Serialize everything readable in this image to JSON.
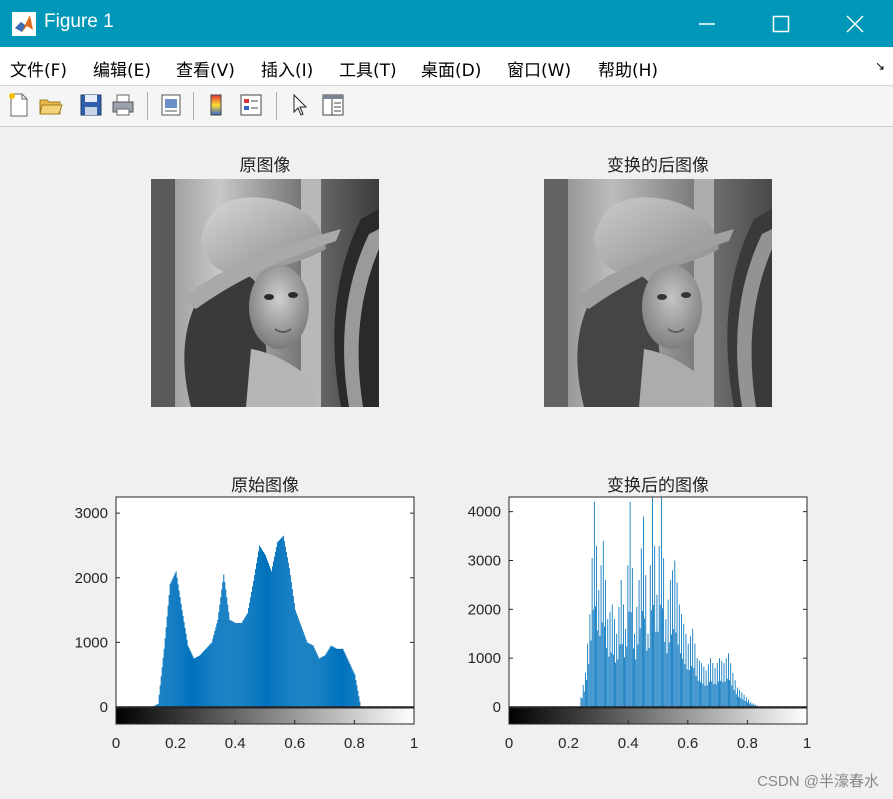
{
  "window": {
    "title": "Figure 1"
  },
  "menu": [
    "文件(F)",
    "编辑(E)",
    "查看(V)",
    "插入(I)",
    "工具(T)",
    "桌面(D)",
    "窗口(W)",
    "帮助(H)"
  ],
  "toolbar_icons": [
    "new-figure-icon",
    "open-file-icon",
    "save-icon",
    "print-icon",
    "print-preview-icon",
    "colorbar-icon",
    "legend-icon",
    "edit-plot-pointer-icon",
    "property-inspector-icon"
  ],
  "images": [
    {
      "title": "原图像"
    },
    {
      "title": "变换的后图像"
    }
  ],
  "colors": {
    "titlebar": "#0097b8",
    "bar": "#0072bd"
  },
  "chart_data": [
    {
      "type": "bar",
      "title": "原始图像",
      "xlim": [
        0,
        1
      ],
      "ylim": [
        0,
        3250
      ],
      "xticks": [
        "0",
        "0.2",
        "0.4",
        "0.6",
        "0.8",
        "1"
      ],
      "yticks": [
        "0",
        "1000",
        "2000",
        "3000"
      ],
      "colorbar": "grayscale",
      "x": [
        0.1,
        0.12,
        0.14,
        0.16,
        0.18,
        0.2,
        0.22,
        0.24,
        0.26,
        0.28,
        0.3,
        0.32,
        0.34,
        0.36,
        0.38,
        0.4,
        0.42,
        0.44,
        0.46,
        0.48,
        0.5,
        0.52,
        0.54,
        0.56,
        0.58,
        0.6,
        0.62,
        0.64,
        0.66,
        0.68,
        0.7,
        0.72,
        0.74,
        0.76,
        0.78,
        0.8,
        0.82,
        0.84,
        0.86,
        0.88,
        0.9
      ],
      "values": [
        0,
        0,
        50,
        900,
        1900,
        2100,
        1500,
        950,
        750,
        800,
        900,
        1000,
        1350,
        2050,
        1350,
        1300,
        1300,
        1450,
        1950,
        2500,
        2350,
        2100,
        2550,
        2650,
        2150,
        1500,
        1250,
        1000,
        950,
        750,
        800,
        950,
        900,
        900,
        700,
        500,
        0,
        0,
        0,
        0,
        0
      ]
    },
    {
      "type": "bar",
      "title": "变换后的图像",
      "xlim": [
        0,
        1
      ],
      "ylim": [
        0,
        4300
      ],
      "xticks": [
        "0",
        "0.2",
        "0.4",
        "0.6",
        "0.8",
        "1"
      ],
      "yticks": [
        "0",
        "1000",
        "2000",
        "3000",
        "4000"
      ],
      "colorbar": "grayscale",
      "x": [
        0.24,
        0.255,
        0.27,
        0.285,
        0.3,
        0.315,
        0.33,
        0.345,
        0.36,
        0.375,
        0.39,
        0.405,
        0.42,
        0.435,
        0.45,
        0.465,
        0.48,
        0.495,
        0.51,
        0.525,
        0.54,
        0.555,
        0.57,
        0.585,
        0.6,
        0.615,
        0.63,
        0.645,
        0.66,
        0.675,
        0.69,
        0.705,
        0.72,
        0.735,
        0.75,
        0.765,
        0.78,
        0.795,
        0.81,
        0.825
      ],
      "values": [
        200,
        700,
        1900,
        4200,
        2400,
        3400,
        1800,
        2100,
        1500,
        2600,
        1600,
        4200,
        1500,
        2600,
        3900,
        1500,
        4300,
        2300,
        4300,
        1800,
        2600,
        3000,
        2100,
        1700,
        1300,
        1600,
        1000,
        900,
        750,
        1000,
        800,
        1000,
        900,
        1100,
        700,
        400,
        300,
        200,
        100,
        50
      ]
    }
  ],
  "watermark": "CSDN @半濠春水"
}
